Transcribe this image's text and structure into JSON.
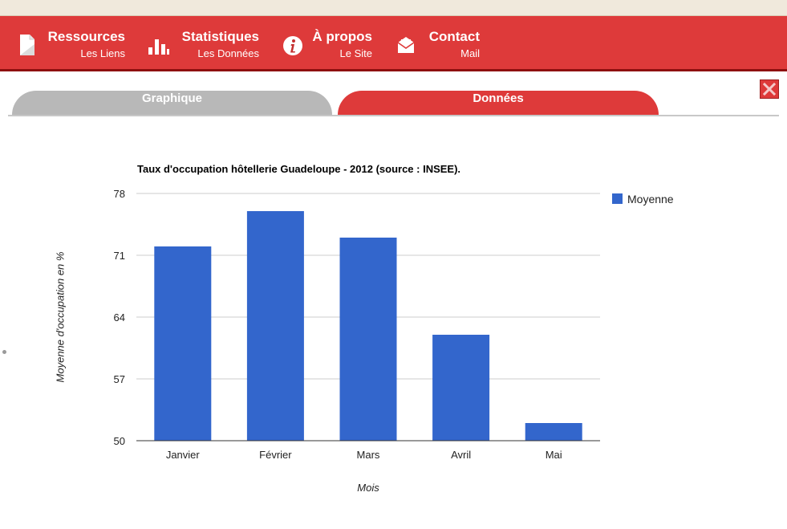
{
  "nav": {
    "items": [
      {
        "title": "Ressources",
        "subtitle": "Les Liens",
        "icon": "document-icon"
      },
      {
        "title": "Statistiques",
        "subtitle": "Les Données",
        "icon": "bar-chart-icon"
      },
      {
        "title": "À propos",
        "subtitle": "Le Site",
        "icon": "info-icon"
      },
      {
        "title": "Contact",
        "subtitle": "Mail",
        "icon": "mail-icon"
      }
    ]
  },
  "tabs": [
    {
      "label": "Graphique",
      "active": false
    },
    {
      "label": "Données",
      "active": true
    }
  ],
  "colors": {
    "brand": "#de3a3a",
    "brand_dark": "#8e1010",
    "tab_inactive": "#b8b8b8",
    "bar": "#3366cc"
  },
  "chart_data": {
    "type": "bar",
    "title": "Taux d'occupation hôtellerie Guadeloupe - 2012 (source : INSEE).",
    "categories": [
      "Janvier",
      "Février",
      "Mars",
      "Avril",
      "Mai"
    ],
    "series": [
      {
        "name": "Moyenne",
        "values": [
          72,
          76,
          73,
          62,
          52
        ]
      }
    ],
    "xlabel": "Mois",
    "ylabel": "Moyenne d'occupation en %",
    "ylim": [
      50,
      78
    ],
    "yticks": [
      50,
      57,
      64,
      71,
      78
    ],
    "grid": true,
    "legend": "right"
  }
}
